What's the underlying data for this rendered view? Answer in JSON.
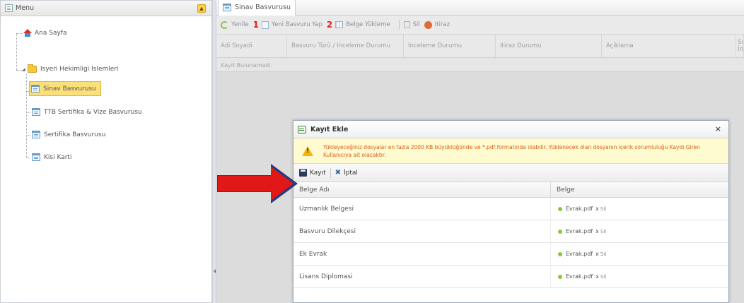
{
  "left_panel": {
    "title": "Menu",
    "collapse_glyph": "▲",
    "items": [
      {
        "label": "Ana Sayfa",
        "icon": "home-icon"
      },
      {
        "label": "Isyeri Hekimligi Islemleri",
        "icon": "folder-icon"
      },
      {
        "label": "Sinav Basvurusu",
        "icon": "form-icon",
        "selected": true
      },
      {
        "label": "TTB Sertifika & Vize Basvurusu",
        "icon": "form-icon"
      },
      {
        "label": "Sertifika Basvurusu",
        "icon": "form-icon"
      },
      {
        "label": "Kisi Karti",
        "icon": "form-icon"
      }
    ]
  },
  "main": {
    "tab_title": "Sinav Basvurusu",
    "toolbar": {
      "refresh": "Yenile",
      "step1": "1",
      "new_application": "Yeni Basvuru Yap",
      "step2": "2",
      "upload_documents": "Belge Yükleme",
      "delete": "Sil",
      "objection": "Itiraz"
    },
    "grid": {
      "columns": [
        "Adi Soyadi",
        "Basvuru Türü / Inceleme Durumu",
        "Inceleme Durumu",
        "Itiraz Durumu",
        "Açiklama",
        "Sı İn"
      ],
      "empty_text": "Kayit Bulunamadi."
    }
  },
  "dialog": {
    "title": "Kayıt Ekle",
    "close": "×",
    "warning": "Yükleyeceğiniz dosyalar en fazla 2000 KB büyüklüğünde ve *.pdf formatında olabilir. Yüklenecek olan dosyanın içerik sorumluluğu Kaydı Giren Kullanıcıya ait olacaktır.",
    "save_label": "Kayıt",
    "cancel_label": "İptal",
    "columns": [
      "Belge Adı",
      "Belge"
    ],
    "rows": [
      {
        "name": "Uzmanlık Belgesi",
        "file": "Evrak.pdf",
        "x": "x",
        "del": "Sil"
      },
      {
        "name": "Basvuru Dilekçesi",
        "file": "Evrak.pdf",
        "x": "x",
        "del": "Sil"
      },
      {
        "name": "Ek Evrak",
        "file": "Evrak.pdf",
        "x": "x",
        "del": "Sil"
      },
      {
        "name": "Lisans Diplomasi",
        "file": "Evrak.pdf",
        "x": "x",
        "del": "Sil"
      }
    ]
  },
  "colors": {
    "accent_red": "#e01818",
    "selected_bg": "#fbe07a",
    "warning_text": "#e05a1a",
    "warning_bg": "#fdfbcf"
  }
}
